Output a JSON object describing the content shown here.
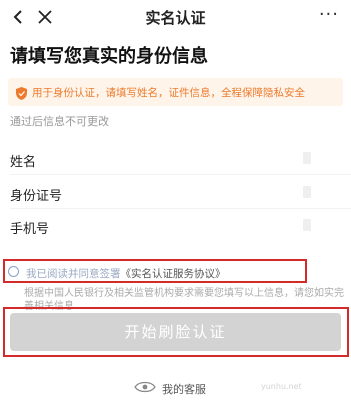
{
  "nav": {
    "back_icon": "‹",
    "close_icon": "✕",
    "title": "实名认证",
    "more_icon": "···"
  },
  "heading": "请填写您真实的身份信息",
  "notice": {
    "icon": "shield-icon",
    "text": "用于身份认证，请填写姓名，证件信息，全程保障隐私安全",
    "color": "#ec7b2d",
    "background": "#fff4ea"
  },
  "subnote": "通过后信息不可更改",
  "fields": [
    {
      "label": "姓名"
    },
    {
      "label": "身份证号"
    },
    {
      "label": "手机号"
    }
  ],
  "agreement": {
    "prefix": "我已阅读并同意签署",
    "link": "《实名认证服务协议》",
    "checked": false
  },
  "legal_text": "根据中国人民银行及相关监管机构要求需要您填写以上信息，请您如实完善相关信息",
  "cta_label": "开始刷脸认证",
  "service_label": "我的客服",
  "watermark": "yunhu.net",
  "colors": {
    "highlight_border": "#d42a2a",
    "button_disabled": "#d3d3d3"
  }
}
